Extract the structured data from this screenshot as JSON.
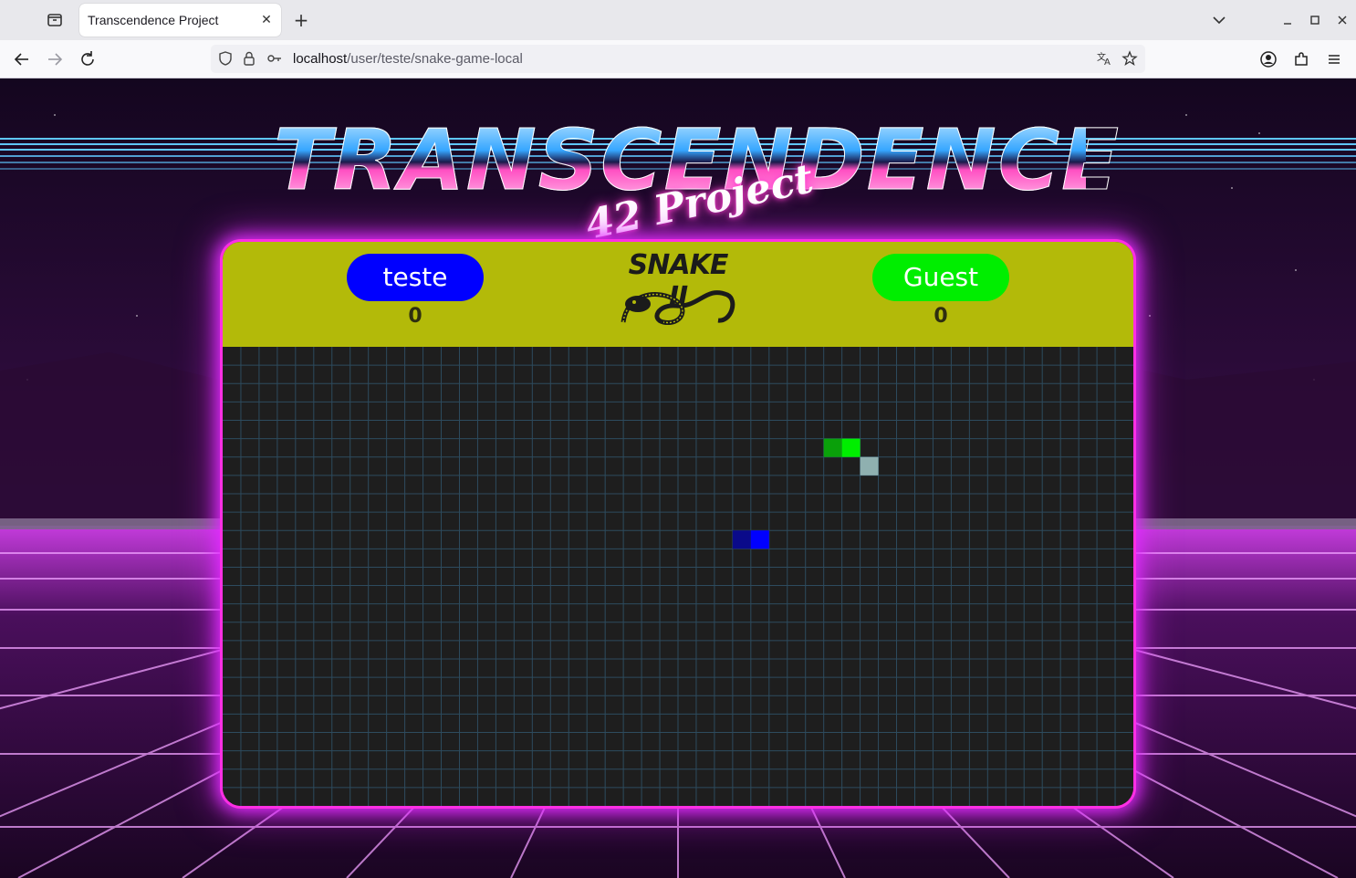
{
  "browser": {
    "tab_title": "Transcendence Project",
    "url_host": "localhost",
    "url_path": "/user/teste/snake-game-local",
    "icons": [
      "tab-list-icon",
      "close-icon",
      "plus-icon",
      "chevron-down-icon",
      "minimize-icon",
      "maximize-icon",
      "window-close-icon",
      "back-arrow-icon",
      "forward-arrow-icon",
      "reload-icon",
      "shield-icon",
      "lock-icon",
      "key-icon",
      "translate-icon",
      "star-icon",
      "account-icon",
      "extensions-icon",
      "menu-icon"
    ]
  },
  "page": {
    "logo_title": "TRANSCENDENCE",
    "logo_subtitle": "42 Project"
  },
  "game": {
    "logo_text": "SNAKE II",
    "player1": {
      "name": "teste",
      "score": "0",
      "color": "#0000ff"
    },
    "player2": {
      "name": "Guest",
      "score": "0",
      "color": "#00ee00"
    },
    "header_color": "#b3ba09",
    "board_color": "#1e1e1e",
    "grid_color": "#2d4b5e",
    "grid": {
      "cols": 50,
      "rows": 25
    },
    "snakes": [
      {
        "name": "player1",
        "cells": [
          [
            28,
            10
          ],
          [
            29,
            10
          ]
        ],
        "head_color": "#0000ff",
        "body_color": "#0a0a8a"
      },
      {
        "name": "player2",
        "cells": [
          [
            33,
            5
          ],
          [
            34,
            5
          ]
        ],
        "head_color": "#00ee00",
        "body_color": "#0aa00a"
      }
    ],
    "food": {
      "cell": [
        35,
        6
      ],
      "color": "#8fb0b0"
    }
  }
}
